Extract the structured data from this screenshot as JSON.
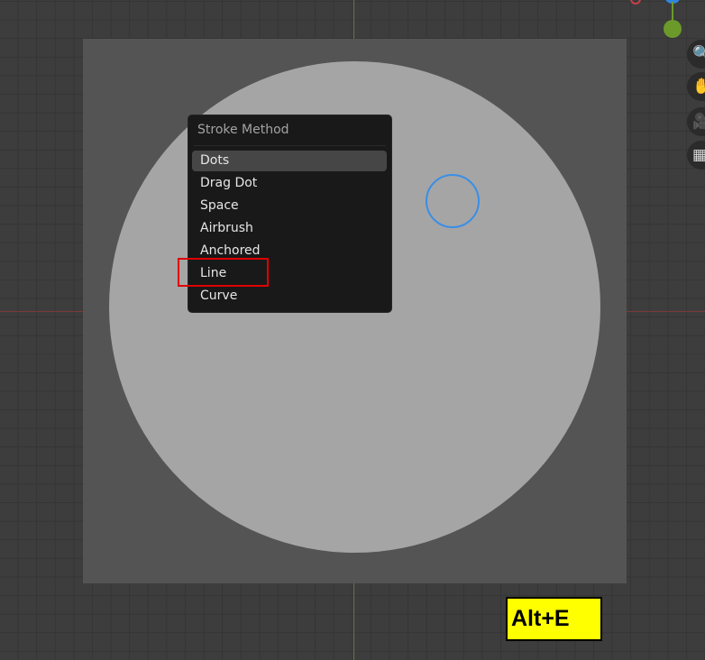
{
  "popup_menu": {
    "title": "Stroke Method",
    "items": [
      {
        "label": "Dots",
        "active": true
      },
      {
        "label": "Drag Dot",
        "active": false
      },
      {
        "label": "Space",
        "active": false
      },
      {
        "label": "Airbrush",
        "active": false
      },
      {
        "label": "Anchored",
        "active": false
      },
      {
        "label": "Line",
        "active": false
      },
      {
        "label": "Curve",
        "active": false
      }
    ]
  },
  "shortcut_hint": "Alt+E",
  "viewport_nav": {
    "buttons": [
      "zoom-icon",
      "pan-hand-icon",
      "camera-icon",
      "grid-icon"
    ]
  },
  "colors": {
    "highlight_box": "#e00000",
    "shortcut_bg": "#ffff00",
    "brush_cursor": "#3a8ee6"
  }
}
